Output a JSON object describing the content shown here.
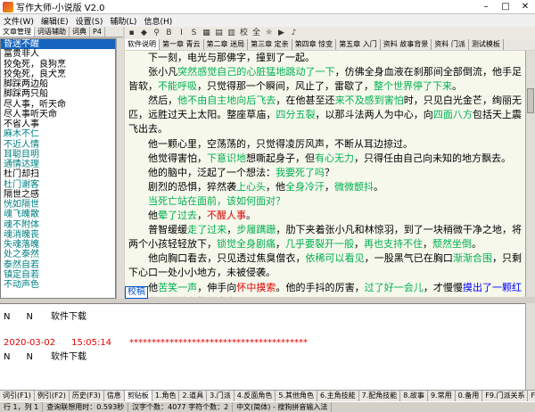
{
  "window": {
    "title": "写作大师-小说版  V2.0"
  },
  "menu": [
    "文件(W)",
    "编辑(E)",
    "设置(S)",
    "辅助(L)",
    "信息(H)"
  ],
  "left_tabs": [
    "文章管理",
    "词语辅助",
    "词典",
    "P4"
  ],
  "left_list": [
    {
      "text": "昏迷不醒",
      "style": "sel"
    },
    {
      "text": "富贵非人",
      "style": ""
    },
    {
      "text": "狡兔死，良狗烹",
      "style": ""
    },
    {
      "text": "狡兔死，良犬烹",
      "style": ""
    },
    {
      "text": "脚踩两边船",
      "style": ""
    },
    {
      "text": "脚踩两只船",
      "style": ""
    },
    {
      "text": "尽人事，听天命",
      "style": ""
    },
    {
      "text": "尽人事听天命",
      "style": ""
    },
    {
      "text": "不省人事",
      "style": ""
    },
    {
      "text": "麻木不仁",
      "style": "teal"
    },
    {
      "text": "不近人情",
      "style": "teal"
    },
    {
      "text": "耳聪目明",
      "style": "teal"
    },
    {
      "text": "通情达理",
      "style": "teal"
    },
    {
      "text": "杜门却扫",
      "style": ""
    },
    {
      "text": "杜门谢客",
      "style": "teal"
    },
    {
      "text": "隔世之感",
      "style": ""
    },
    {
      "text": "恍如隔世",
      "style": "teal"
    },
    {
      "text": "魂飞魄散",
      "style": "teal"
    },
    {
      "text": "魂不附体",
      "style": "teal"
    },
    {
      "text": "魂消魄丧",
      "style": "teal"
    },
    {
      "text": "失魂落魄",
      "style": "teal"
    },
    {
      "text": "处之泰然",
      "style": "teal"
    },
    {
      "text": "泰然自若",
      "style": "teal"
    },
    {
      "text": "镇定自若",
      "style": "teal"
    },
    {
      "text": "不动声色",
      "style": "teal"
    }
  ],
  "toolbar": {
    "icons": [
      "save-icon",
      "undo-icon",
      "binoculars-icon",
      "bold-icon",
      "italic-icon",
      "strike-icon",
      "calendar-icon",
      "grid-icon",
      "book-icon",
      "check-icon",
      "full-icon",
      "bulb-icon",
      "play-icon",
      "speaker-icon"
    ],
    "glyphs": [
      "▪",
      "◆",
      "⚲",
      "B",
      "I",
      "S",
      "▦",
      "▤",
      "▥",
      "校",
      "全",
      "☼",
      "▶",
      "♪"
    ]
  },
  "chapter_tabs": [
    "软件说明",
    "第一章 青云",
    "第二章 迷局",
    "第三章 定亲",
    "第四章 惊变",
    "第五章 入门",
    "资料 故事背景",
    "资料 门派",
    "测试模板"
  ],
  "editor": {
    "paragraphs": [
      [
        [
          "下一刻，电光与那佛字，撞到了一起。",
          ""
        ]
      ],
      [
        [
          "张小凡",
          ""
        ],
        [
          "突然感觉自己的心脏猛地跳动了一下",
          "g"
        ],
        [
          "，仿佛全身血液在刹那间全部倒流，他手足皆软，",
          ""
        ],
        [
          "不能呼吸",
          "g"
        ],
        [
          "，只觉得那一个瞬间，风止了，雷歇了，",
          ""
        ],
        [
          "整个世界停了下来",
          "g"
        ],
        [
          "。",
          ""
        ]
      ],
      [
        [
          "然后，",
          ""
        ],
        [
          "他不由自主地向后飞去",
          "g"
        ],
        [
          "，在他甚至还",
          ""
        ],
        [
          "来不及感到害怕",
          "g"
        ],
        [
          "时，只见白光金芒，绚丽无匹，远胜过天上太阳。整座草庙，",
          ""
        ],
        [
          "四分五裂",
          "g"
        ],
        [
          "，以那斗法两人为中心，向",
          ""
        ],
        [
          "四面八方",
          "g"
        ],
        [
          "包括天上震飞出去。",
          ""
        ]
      ],
      [
        [
          "他一颗心里，空荡荡的，只觉得凌厉风声，不断从耳边掠过。",
          ""
        ]
      ],
      [
        [
          "他觉得害怕，",
          ""
        ],
        [
          "下意识地",
          "g"
        ],
        [
          "想嘶起身子，但",
          ""
        ],
        [
          "有心无力",
          "g"
        ],
        [
          "，只得任由自己向未知的地方飘去。",
          ""
        ]
      ],
      [
        [
          "他的脑中，泛起了一个想法：",
          ""
        ],
        [
          "我要死了吗",
          "g"
        ],
        [
          "？",
          ""
        ]
      ],
      [
        [
          "剧烈的恐惧，猝然袭",
          ""
        ],
        [
          "上心头",
          "g"
        ],
        [
          "，他",
          ""
        ],
        [
          "全身冷汗",
          "g"
        ],
        [
          "，",
          ""
        ],
        [
          "微微颤抖",
          "g"
        ],
        [
          "。",
          ""
        ]
      ],
      [
        [
          "当死亡站在面前，该如何面对？",
          "g"
        ]
      ],
      [
        [
          "他",
          ""
        ],
        [
          "晕了过去",
          "g"
        ],
        [
          "，",
          ""
        ],
        [
          "不醒人事",
          "r"
        ],
        [
          "。",
          ""
        ]
      ],
      [
        [
          "普智缓缓",
          ""
        ],
        [
          "走了过来",
          "g"
        ],
        [
          "，",
          ""
        ],
        [
          "步履蹒跚",
          "g"
        ],
        [
          "，肋下夹着张小凡和林惊羽，到了一块稍微干净之地，将两个小孩轻轻放下，",
          ""
        ],
        [
          "锁觉全身剧痛",
          "g"
        ],
        [
          "，",
          ""
        ],
        [
          "几乎要裂开一般",
          "g"
        ],
        [
          "，",
          ""
        ],
        [
          "再也支持不住",
          "g"
        ],
        [
          "，",
          ""
        ],
        [
          "颓然坐倒",
          "g"
        ],
        [
          "。",
          ""
        ]
      ],
      [
        [
          "他向胸口看去，只见透过焦臭僧衣，",
          ""
        ],
        [
          "依稀可以看见",
          "g"
        ],
        [
          "，一股黑气已在胸口",
          ""
        ],
        [
          "渐渐合围",
          "g"
        ],
        [
          "，只剩下心口一处小小地方，未被侵袭。",
          ""
        ]
      ],
      [
        [
          "他",
          ""
        ],
        [
          "苦笑一声",
          "g"
        ],
        [
          "，伸手向",
          ""
        ],
        [
          "怀中摸索",
          "r"
        ],
        [
          "。他的手抖的厉害，",
          ""
        ],
        [
          "过了好一会儿",
          "g"
        ],
        [
          "，才慢慢",
          ""
        ],
        [
          "摸出了一颗红色药丸",
          "b"
        ],
        [
          "，",
          ""
        ],
        [
          "约莫",
          "r"
        ],
        [
          "有指头大小，平平无起。",
          ""
        ]
      ],
      [
        [
          "普智吁了一口气",
          "b"
        ],
        [
          "，低声道：“",
          ""
        ],
        [
          "想不到还是让那魔头给逃了",
          "p"
        ],
        [
          "，我到底还是要把他这一颗",
          ""
        ]
      ]
    ]
  },
  "tooltip": "校稿",
  "log": {
    "lines": [
      {
        "a": "N",
        "b": "N",
        "c": "软件下载",
        "style": ""
      },
      {
        "a": "2020-03-02",
        "b": "15:05:14",
        "c": "****************************************",
        "style": "red"
      },
      {
        "a": "N",
        "b": "N",
        "c": "软件下载",
        "style": ""
      }
    ]
  },
  "bottom_tabs": [
    "词引(F1)",
    "例引(F2)",
    "历史(F3)",
    "信息",
    "剪贴板",
    "1.角色",
    "2.道具",
    "3.门派",
    "4.反面角色",
    "5.其他角色",
    "6.主角技能",
    "7.配角技能",
    "8.故事",
    "9.常用",
    "0.备用",
    "F9.门派关系",
    "F10.任务"
  ],
  "status": [
    "行 1，列 1",
    "查询联想用时：0.593秒",
    "汉字个数：4077 字符个数：2",
    "中文(简体) - 搜狗拼音输入法"
  ]
}
